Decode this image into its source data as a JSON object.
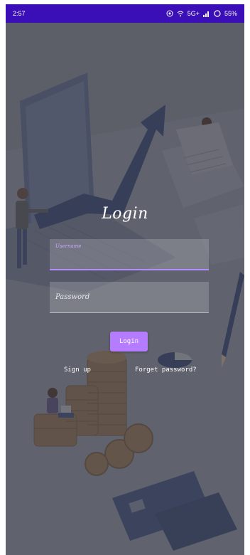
{
  "status_bar": {
    "time": "2:57",
    "network": "5G+",
    "battery": "55%"
  },
  "login": {
    "title": "Login",
    "username_label": "Username",
    "username_value": "",
    "password_placeholder": "Password",
    "button_label": "Login",
    "signup_label": "Sign up",
    "forget_label": "Forget password?"
  },
  "colors": {
    "status_bar": "#3a0fb8",
    "accent": "#b57cff"
  }
}
